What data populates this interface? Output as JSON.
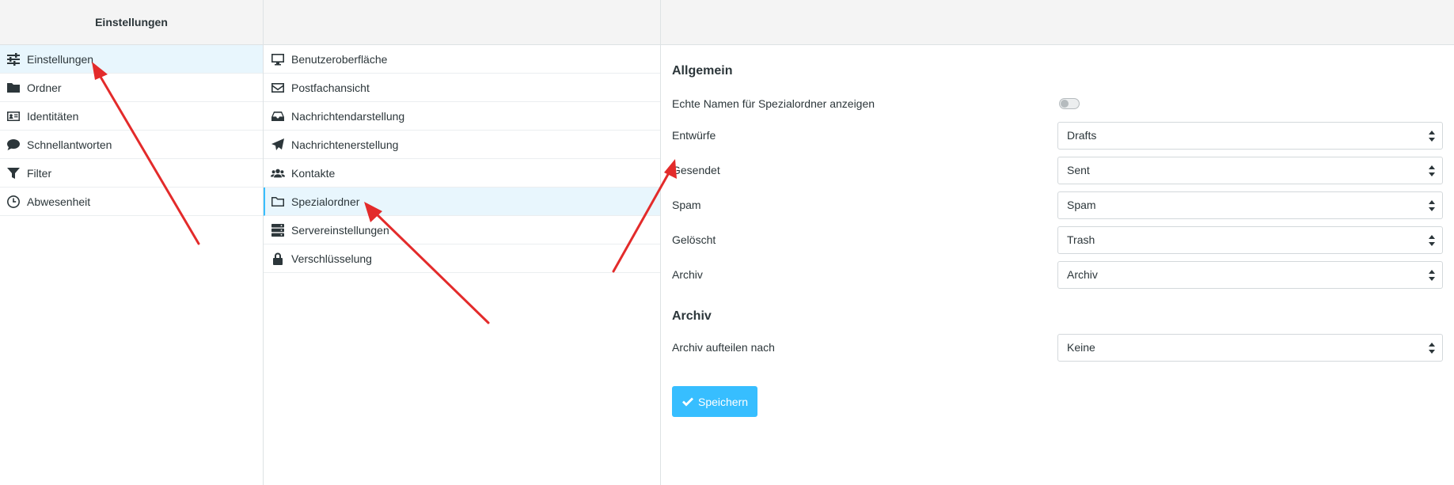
{
  "col1": {
    "title": "Einstellungen",
    "items": [
      {
        "label": "Einstellungen",
        "icon": "sliders-icon"
      },
      {
        "label": "Ordner",
        "icon": "folder-icon"
      },
      {
        "label": "Identitäten",
        "icon": "id-card-icon"
      },
      {
        "label": "Schnellantworten",
        "icon": "comment-icon"
      },
      {
        "label": "Filter",
        "icon": "filter-icon"
      },
      {
        "label": "Abwesenheit",
        "icon": "clock-icon"
      }
    ],
    "active_index": 0
  },
  "col2": {
    "items": [
      {
        "label": "Benutzeroberfläche",
        "icon": "monitor-icon"
      },
      {
        "label": "Postfachansicht",
        "icon": "envelope-icon"
      },
      {
        "label": "Nachrichtendarstellung",
        "icon": "inbox-icon"
      },
      {
        "label": "Nachrichtenerstellung",
        "icon": "paper-plane-icon"
      },
      {
        "label": "Kontakte",
        "icon": "users-icon"
      },
      {
        "label": "Spezialordner",
        "icon": "folder-open-icon"
      },
      {
        "label": "Servereinstellungen",
        "icon": "server-icon"
      },
      {
        "label": "Verschlüsselung",
        "icon": "lock-icon"
      }
    ],
    "active_index": 5
  },
  "main": {
    "section_general": "Allgemein",
    "show_real_names_label": "Echte Namen für Spezialordner anzeigen",
    "show_real_names_enabled": false,
    "drafts_label": "Entwürfe",
    "drafts_value": "Drafts",
    "sent_label": "Gesendet",
    "sent_value": "Sent",
    "spam_label": "Spam",
    "spam_value": "Spam",
    "trash_label": "Gelöscht",
    "trash_value": "Trash",
    "archive_label": "Archiv",
    "archive_value": "Archiv",
    "section_archive": "Archiv",
    "archive_split_label": "Archiv aufteilen nach",
    "archive_split_value": "Keine",
    "save_label": "Speichern"
  },
  "colors": {
    "accent": "#37beff",
    "active_bg": "#e8f6fd",
    "annotation_arrow": "#e32b2b"
  }
}
